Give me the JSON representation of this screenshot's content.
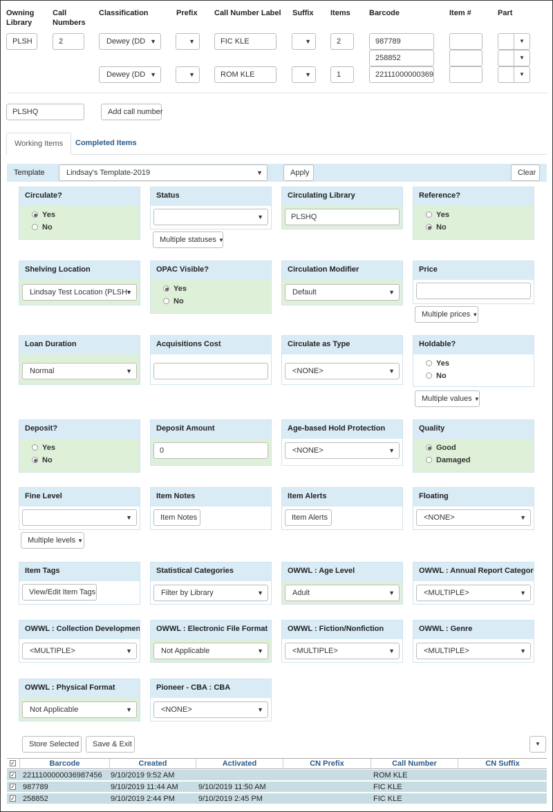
{
  "call_number_table": {
    "headers": {
      "owning_library": "Owning Library",
      "call_numbers": "Call Numbers",
      "classification": "Classification",
      "prefix": "Prefix",
      "call_number_label": "Call Number Label",
      "suffix": "Suffix",
      "items": "Items",
      "barcode": "Barcode",
      "item_num": "Item #",
      "part": "Part"
    },
    "owning_library": "PLSH",
    "call_numbers": "2",
    "rows": [
      {
        "classification": "Dewey (DD",
        "call_number_label": "FIC KLE",
        "items": "2",
        "barcodes": [
          "987789",
          "258852"
        ]
      },
      {
        "classification": "Dewey (DD",
        "call_number_label": "ROM KLE",
        "items": "1",
        "barcodes": [
          "22111000000369"
        ]
      }
    ],
    "new_library": "PLSHQ",
    "add_call_number_label": "Add call number"
  },
  "tabs": [
    {
      "label": "Working Items"
    },
    {
      "label": "Completed Items"
    }
  ],
  "template": {
    "label": "Template",
    "value": "Lindsay's Template-2019",
    "apply_label": "Apply",
    "clear_label": "Clear"
  },
  "fields": {
    "circulate": {
      "title": "Circulate?",
      "yes": "Yes",
      "no": "No"
    },
    "status": {
      "title": "Status",
      "value": "",
      "multi_label": "Multiple statuses"
    },
    "circulating_library": {
      "title": "Circulating Library",
      "value": "PLSHQ"
    },
    "reference": {
      "title": "Reference?",
      "yes": "Yes",
      "no": "No"
    },
    "shelving_location": {
      "title": "Shelving Location",
      "value": "Lindsay Test Location (PLSH"
    },
    "opac_visible": {
      "title": "OPAC Visible?",
      "yes": "Yes",
      "no": "No"
    },
    "circulation_modifier": {
      "title": "Circulation Modifier",
      "value": "Default"
    },
    "price": {
      "title": "Price",
      "value": "",
      "multi_label": "Multiple prices"
    },
    "loan_duration": {
      "title": "Loan Duration",
      "value": "Normal"
    },
    "acquisitions_cost": {
      "title": "Acquisitions Cost",
      "value": ""
    },
    "circulate_as_type": {
      "title": "Circulate as Type",
      "value": "<NONE>"
    },
    "holdable": {
      "title": "Holdable?",
      "yes": "Yes",
      "no": "No",
      "multi_label": "Multiple values"
    },
    "deposit": {
      "title": "Deposit?",
      "yes": "Yes",
      "no": "No"
    },
    "deposit_amount": {
      "title": "Deposit Amount",
      "value": "0"
    },
    "age_hold": {
      "title": "Age-based Hold Protection",
      "value": "<NONE>"
    },
    "quality": {
      "title": "Quality",
      "good": "Good",
      "damaged": "Damaged"
    },
    "fine_level": {
      "title": "Fine Level",
      "value": "",
      "multi_label": "Multiple levels"
    },
    "item_notes": {
      "title": "Item Notes",
      "button": "Item Notes"
    },
    "item_alerts": {
      "title": "Item Alerts",
      "button": "Item Alerts"
    },
    "floating": {
      "title": "Floating",
      "value": "<NONE>"
    },
    "item_tags": {
      "title": "Item Tags",
      "button": "View/Edit Item Tags"
    },
    "stat_cats": {
      "title": "Statistical Categories",
      "value": "Filter by Library"
    },
    "age_level": {
      "title": "OWWL : Age Level",
      "value": "Adult"
    },
    "annual_report": {
      "title": "OWWL : Annual Report Category",
      "value": "<MULTIPLE>"
    },
    "collection_dev": {
      "title": "OWWL : Collection Development",
      "value": "<MULTIPLE>"
    },
    "electronic_format": {
      "title": "OWWL : Electronic File Format",
      "value": "Not Applicable"
    },
    "fiction": {
      "title": "OWWL : Fiction/Nonfiction",
      "value": "<MULTIPLE>"
    },
    "genre": {
      "title": "OWWL : Genre",
      "value": "<MULTIPLE>"
    },
    "physical_format": {
      "title": "OWWL : Physical Format",
      "value": "Not Applicable"
    },
    "pioneer_cba": {
      "title": "Pioneer - CBA : CBA",
      "value": "<NONE>"
    }
  },
  "actions": {
    "store_selected": "Store Selected",
    "save_exit": "Save & Exit"
  },
  "items_table": {
    "columns": [
      "Barcode",
      "Created",
      "Activated",
      "CN Prefix",
      "Call Number",
      "CN Suffix"
    ],
    "rows": [
      {
        "barcode": "2211100000036987456",
        "created": "9/10/2019 9:52 AM",
        "activated": "",
        "cn_prefix": "",
        "call_number": "ROM KLE",
        "cn_suffix": ""
      },
      {
        "barcode": "987789",
        "created": "9/10/2019 11:44 AM",
        "activated": "9/10/2019 11:50 AM",
        "cn_prefix": "",
        "call_number": "FIC KLE",
        "cn_suffix": ""
      },
      {
        "barcode": "258852",
        "created": "9/10/2019 2:44 PM",
        "activated": "9/10/2019 2:45 PM",
        "cn_prefix": "",
        "call_number": "FIC KLE",
        "cn_suffix": ""
      }
    ]
  },
  "colors": {
    "card_header": "#d9ebf5",
    "card_body_green": "#dff0d8",
    "row_highlight": "#c8dde3",
    "link": "#2a5a8a"
  }
}
